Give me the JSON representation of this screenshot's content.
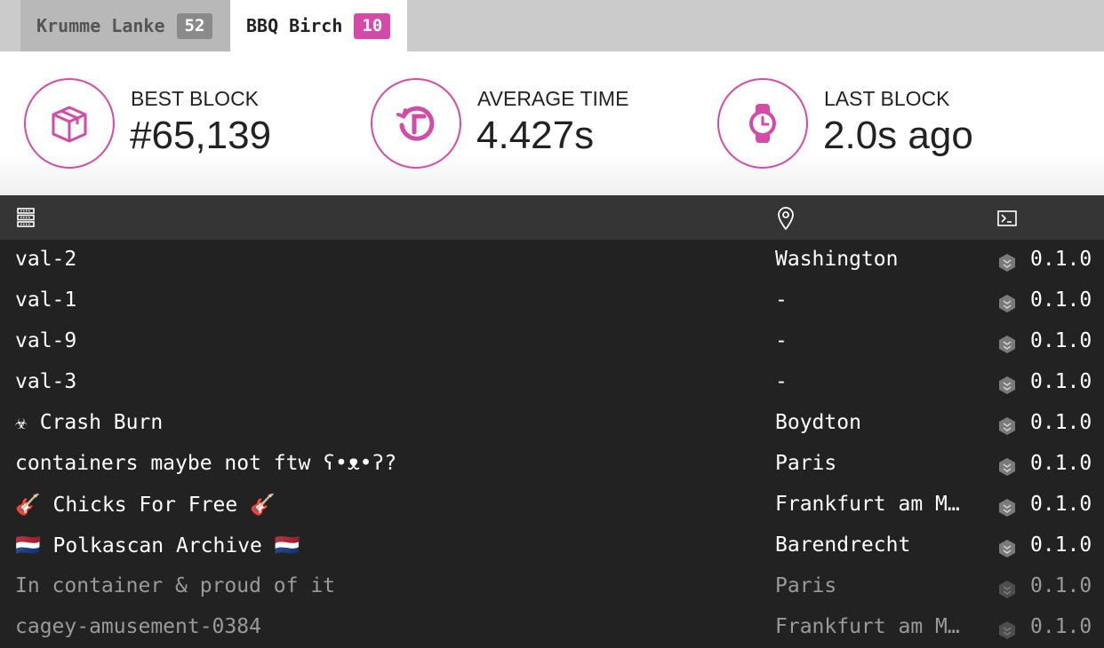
{
  "tabs": [
    {
      "label": "Krumme Lanke",
      "count": "52"
    },
    {
      "label": "BBQ Birch",
      "count": "10"
    }
  ],
  "stats": [
    {
      "label": "BEST BLOCK",
      "value": "#65,139",
      "icon": "cube-icon"
    },
    {
      "label": "AVERAGE TIME",
      "value": "4.427s",
      "icon": "timer-refresh-icon"
    },
    {
      "label": "LAST BLOCK",
      "value": "2.0s ago",
      "icon": "watch-icon"
    }
  ],
  "table": {
    "header_icons": [
      "server-icon",
      "location-pin-icon",
      "terminal-icon"
    ],
    "rows": [
      {
        "name": "val-2",
        "location": "Washington",
        "version": "0.1.0"
      },
      {
        "name": "val-1",
        "location": "-",
        "version": "0.1.0"
      },
      {
        "name": "val-9",
        "location": "-",
        "version": "0.1.0"
      },
      {
        "name": "val-3",
        "location": "-",
        "version": "0.1.0"
      },
      {
        "name": "☣ Crash Burn",
        "location": "Boydton",
        "version": "0.1.0"
      },
      {
        "name": "containers maybe not ftw ʕ•ᴥ•ʔ?",
        "location": "Paris",
        "version": "0.1.0"
      },
      {
        "name": "🎸 Chicks For Free 🎸",
        "location": "Frankfurt am M…",
        "version": "0.1.0"
      },
      {
        "name": "🇳🇱 Polkascan Archive 🇳🇱",
        "location": "Barendrecht",
        "version": "0.1.0"
      },
      {
        "name": "In container & proud of it",
        "location": "Paris",
        "version": "0.1.0"
      },
      {
        "name": "cagey-amusement-0384",
        "location": "Frankfurt am M…",
        "version": "0.1.0"
      }
    ]
  },
  "colors": {
    "accent": "#d54aa9",
    "table_bg": "#222222",
    "header_bg": "#353535"
  }
}
